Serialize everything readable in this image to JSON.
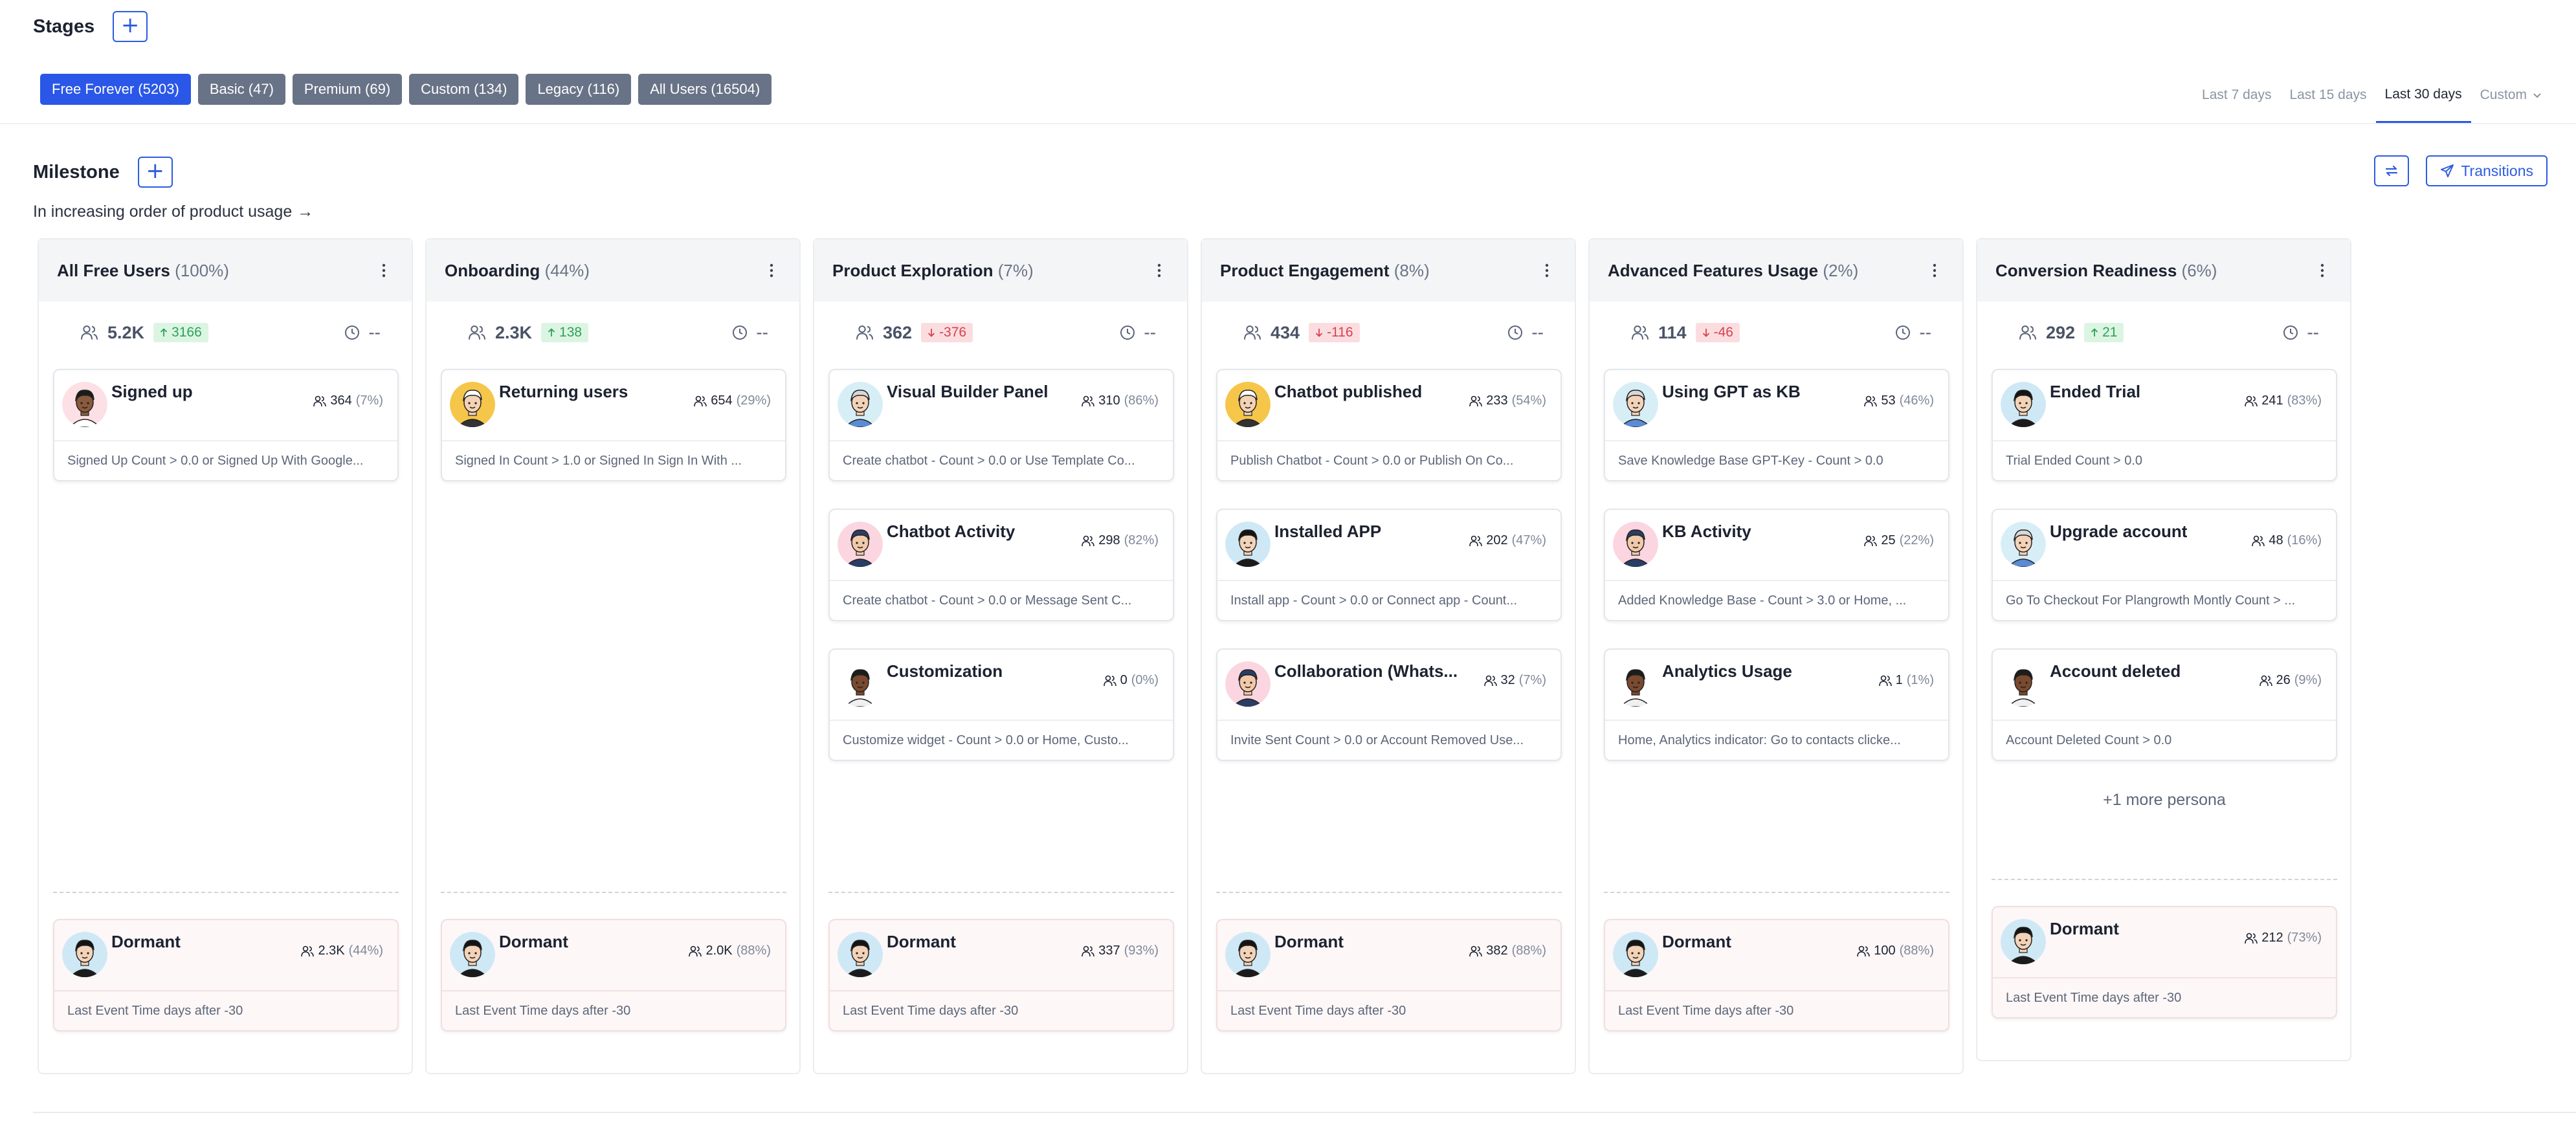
{
  "stages": {
    "title": "Stages",
    "add": "+"
  },
  "segments": [
    {
      "label": "Free Forever  (5203)",
      "active": true
    },
    {
      "label": "Basic  (47)",
      "active": false
    },
    {
      "label": "Premium  (69)",
      "active": false
    },
    {
      "label": "Custom  (134)",
      "active": false
    },
    {
      "label": "Legacy  (116)",
      "active": false
    },
    {
      "label": "All Users  (16504)",
      "active": false
    }
  ],
  "range_tabs": [
    "Last 7 days",
    "Last 15 days",
    "Last 30 days",
    "Custom"
  ],
  "active_range": "Last 30 days",
  "milestone": {
    "title": "Milestone",
    "add": "+",
    "subtitle": "In increasing order of product usage",
    "subtitle_arrow": "→",
    "transitions": "Transitions"
  },
  "colors": {
    "accent": "#2a57e8",
    "segment": "#697387",
    "up": "#2ea158",
    "down": "#d7424f"
  },
  "columns": [
    {
      "title": "All Free Users",
      "pct": "(100%)",
      "total": "5.2K",
      "delta": "3166",
      "dir": "up",
      "time": "--",
      "cards": [
        {
          "title": "Signed up",
          "count": "364",
          "pct": "(7%)",
          "desc": "Signed Up Count > 0.0 or Signed Up With Google...",
          "avatar": "man-dark"
        }
      ],
      "dormant": {
        "title": "Dormant",
        "count": "2.3K",
        "pct": "(44%)",
        "desc": "Last Event Time days after -30"
      }
    },
    {
      "title": "Onboarding",
      "pct": "(44%)",
      "total": "2.3K",
      "delta": "138",
      "dir": "up",
      "time": "--",
      "cards": [
        {
          "title": "Returning users",
          "count": "654",
          "pct": "(29%)",
          "desc": "Signed In Count > 1.0 or Signed In Sign In With ...",
          "avatar": "woman-yellow"
        }
      ],
      "dormant": {
        "title": "Dormant",
        "count": "2.0K",
        "pct": "(88%)",
        "desc": "Last Event Time days after -30"
      }
    },
    {
      "title": "Product Exploration",
      "pct": "(7%)",
      "total": "362",
      "delta": "-376",
      "dir": "down",
      "time": "--",
      "cards": [
        {
          "title": "Visual Builder Panel",
          "count": "310",
          "pct": "(86%)",
          "desc": "Create chatbot - Count > 0.0 or Use Template Co...",
          "avatar": "man-bald"
        },
        {
          "title": "Chatbot Activity",
          "count": "298",
          "pct": "(82%)",
          "desc": "Create chatbot - Count > 0.0 or Message Sent C...",
          "avatar": "woman-pink"
        },
        {
          "title": "Customization",
          "count": "0",
          "pct": "(0%)",
          "desc": "Customize widget - Count > 0.0 or Home, Custo...",
          "avatar": "man-beard"
        }
      ],
      "dormant": {
        "title": "Dormant",
        "count": "337",
        "pct": "(93%)",
        "desc": "Last Event Time days after -30"
      }
    },
    {
      "title": "Product Engagement",
      "pct": "(8%)",
      "total": "434",
      "delta": "-116",
      "dir": "down",
      "time": "--",
      "cards": [
        {
          "title": "Chatbot published",
          "count": "233",
          "pct": "(54%)",
          "desc": "Publish Chatbot - Count > 0.0 or Publish On Co...",
          "avatar": "woman-yellow"
        },
        {
          "title": "Installed APP",
          "count": "202",
          "pct": "(47%)",
          "desc": "Install app - Count > 0.0 or Connect app - Count...",
          "avatar": "woman-dark"
        },
        {
          "title": "Collaboration (Whats...",
          "count": "32",
          "pct": "(7%)",
          "desc": "Invite Sent Count > 0.0 or Account Removed Use...",
          "avatar": "woman-pink"
        }
      ],
      "dormant": {
        "title": "Dormant",
        "count": "382",
        "pct": "(88%)",
        "desc": "Last Event Time days after -30"
      }
    },
    {
      "title": "Advanced Features Usage",
      "pct": "(2%)",
      "total": "114",
      "delta": "-46",
      "dir": "down",
      "time": "--",
      "cards": [
        {
          "title": "Using GPT as KB",
          "count": "53",
          "pct": "(46%)",
          "desc": "Save Knowledge Base GPT-Key - Count > 0.0",
          "avatar": "man-bald"
        },
        {
          "title": "KB Activity",
          "count": "25",
          "pct": "(22%)",
          "desc": "Added Knowledge Base - Count > 3.0 or Home, ...",
          "avatar": "woman-pink"
        },
        {
          "title": "Analytics Usage",
          "count": "1",
          "pct": "(1%)",
          "desc": "Home, Analytics indicator: Go to contacts clicke...",
          "avatar": "man-beard"
        }
      ],
      "dormant": {
        "title": "Dormant",
        "count": "100",
        "pct": "(88%)",
        "desc": "Last Event Time days after -30"
      }
    },
    {
      "title": "Conversion Readiness",
      "pct": "(6%)",
      "total": "292",
      "delta": "21",
      "dir": "up",
      "time": "--",
      "cards": [
        {
          "title": "Ended Trial",
          "count": "241",
          "pct": "(83%)",
          "desc": "Trial Ended Count > 0.0",
          "avatar": "woman-dark"
        },
        {
          "title": "Upgrade account",
          "count": "48",
          "pct": "(16%)",
          "desc": "Go To Checkout For Plangrowth Montly Count > ...",
          "avatar": "man-bald"
        },
        {
          "title": "Account deleted",
          "count": "26",
          "pct": "(9%)",
          "desc": "Account Deleted Count > 0.0",
          "avatar": "man-beard"
        }
      ],
      "more": "+1 more persona",
      "dormant": {
        "title": "Dormant",
        "count": "212",
        "pct": "(73%)",
        "desc": "Last Event Time days after -30"
      }
    }
  ]
}
